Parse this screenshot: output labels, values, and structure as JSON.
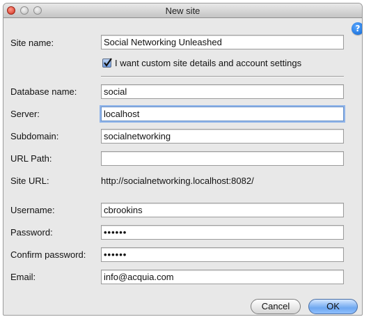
{
  "window": {
    "title": "New site"
  },
  "help": {
    "glyph": "?"
  },
  "form": {
    "site_name": {
      "label": "Site name:",
      "value": "Social Networking Unleashed"
    },
    "custom_checkbox": {
      "label": "I want custom site details and account settings",
      "checked": true
    },
    "database_name": {
      "label": "Database name:",
      "value": "social"
    },
    "server": {
      "label": "Server:",
      "value": "localhost"
    },
    "subdomain": {
      "label": "Subdomain:",
      "value": "socialnetworking"
    },
    "url_path": {
      "label": "URL Path:",
      "value": ""
    },
    "site_url": {
      "label": "Site URL:",
      "value": "http://socialnetworking.localhost:8082/"
    },
    "username": {
      "label": "Username:",
      "value": "cbrookins"
    },
    "password": {
      "label": "Password:",
      "value": "••••••"
    },
    "confirm_password": {
      "label": "Confirm password:",
      "value": "••••••"
    },
    "email": {
      "label": "Email:",
      "value": "info@acquia.com"
    }
  },
  "buttons": {
    "cancel": "Cancel",
    "ok": "OK"
  },
  "colors": {
    "accent": "#6fa8f0",
    "help": "#0b63d1",
    "close": "#d3301f"
  }
}
